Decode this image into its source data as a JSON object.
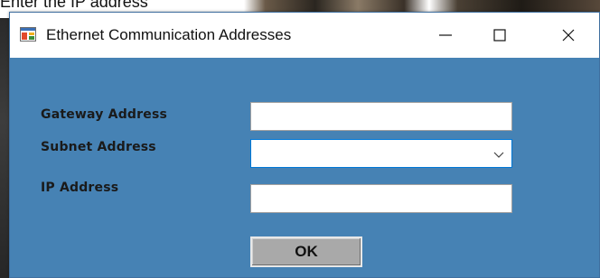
{
  "background": {
    "instruction_text": "Enter the IP address"
  },
  "window": {
    "title": "Ethernet Communication Addresses",
    "icons": {
      "app": "app-window-icon",
      "minimize": "minimize-icon",
      "maximize": "maximize-icon",
      "close": "close-icon"
    },
    "client_background": "#4682b4"
  },
  "form": {
    "gateway_label": "Gateway Address",
    "gateway_value": "",
    "subnet_label": "Subnet Address",
    "subnet_value": "",
    "ip_label": "IP Address",
    "ip_value": "",
    "ok_label": "OK"
  }
}
